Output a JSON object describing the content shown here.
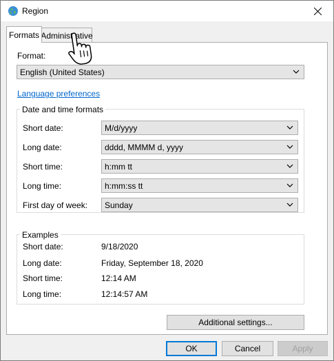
{
  "window": {
    "title": "Region",
    "close_icon": "close-icon",
    "app_icon": "globe-icon"
  },
  "tabs": [
    {
      "label": "Formats",
      "selected": true
    },
    {
      "label": "Administrative",
      "selected": false
    }
  ],
  "format": {
    "label": "Format:",
    "value": "English (United States)"
  },
  "language_link": "Language preferences",
  "date_time_formats": {
    "title": "Date and time formats",
    "rows": [
      {
        "label": "Short date:",
        "value": "M/d/yyyy"
      },
      {
        "label": "Long date:",
        "value": "dddd, MMMM d, yyyy"
      },
      {
        "label": "Short time:",
        "value": "h:mm tt"
      },
      {
        "label": "Long time:",
        "value": "h:mm:ss tt"
      },
      {
        "label": "First day of week:",
        "value": "Sunday"
      }
    ]
  },
  "examples": {
    "title": "Examples",
    "rows": [
      {
        "label": "Short date:",
        "value": "9/18/2020"
      },
      {
        "label": "Long date:",
        "value": "Friday, September 18, 2020"
      },
      {
        "label": "Short time:",
        "value": "12:14 AM"
      },
      {
        "label": "Long time:",
        "value": "12:14:57 AM"
      }
    ]
  },
  "buttons": {
    "additional_settings": "Additional settings...",
    "ok": "OK",
    "cancel": "Cancel",
    "apply": "Apply"
  },
  "colors": {
    "link": "#0066cc",
    "default_button_border": "#0078d7"
  }
}
